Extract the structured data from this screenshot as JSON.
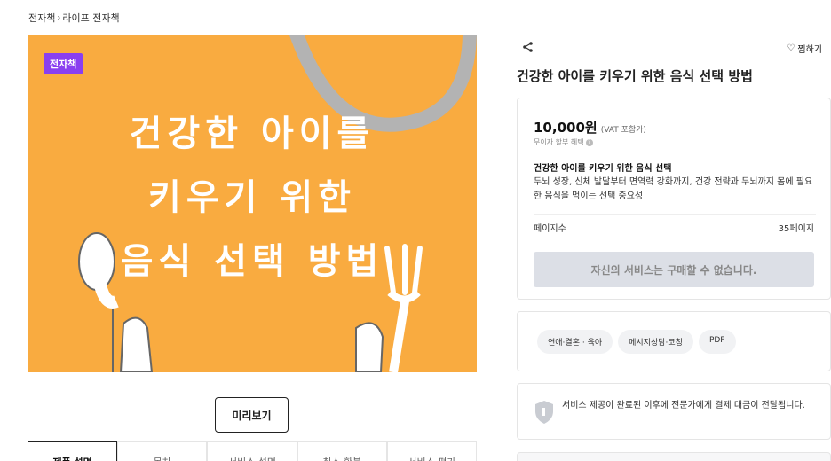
{
  "breadcrumb": {
    "root": "전자책",
    "separator": "›",
    "current": "라이프 전자책"
  },
  "cover": {
    "badge": "전자책",
    "lines": [
      "건강한 아이를",
      "키우기 위한",
      "음식 선택 방법"
    ],
    "background": "#f9ab40",
    "badge_color": "#8a3ff0"
  },
  "preview_button": "미리보기",
  "tabs": [
    "제품 설명",
    "목차",
    "서비스 설명",
    "취소·환불",
    "서비스 평가"
  ],
  "product": {
    "wishlist_label": "찜하기",
    "title": "건강한 아이를 키우기 위한 음식 선택 방법",
    "price": "10,000원",
    "vat": "(VAT 포함가)",
    "installment": "무이자 할부 혜택",
    "desc_title": "건강한 아이를 키우기 위한 음식 선택",
    "desc_body": "두뇌 성장, 신체 발달부터 면역력 강화까지, 건강 전략과 두뇌까지 몸에 필요한 음식을 먹이는 선택 중요성",
    "pages_label": "페이지수",
    "pages_value": "35페이지",
    "buy_button": "자신의 서비스는 구매할 수 없습니다."
  },
  "tags": [
    "연애·결혼 · 육아",
    "메시지상담·코칭",
    "PDF"
  ],
  "notice": "서비스 제공이 완료된 이후에 전문가에게 결제 대금이 전달됩니다.",
  "icons": [
    "share-icon",
    "heart-icon",
    "info-icon",
    "shield-icon"
  ]
}
